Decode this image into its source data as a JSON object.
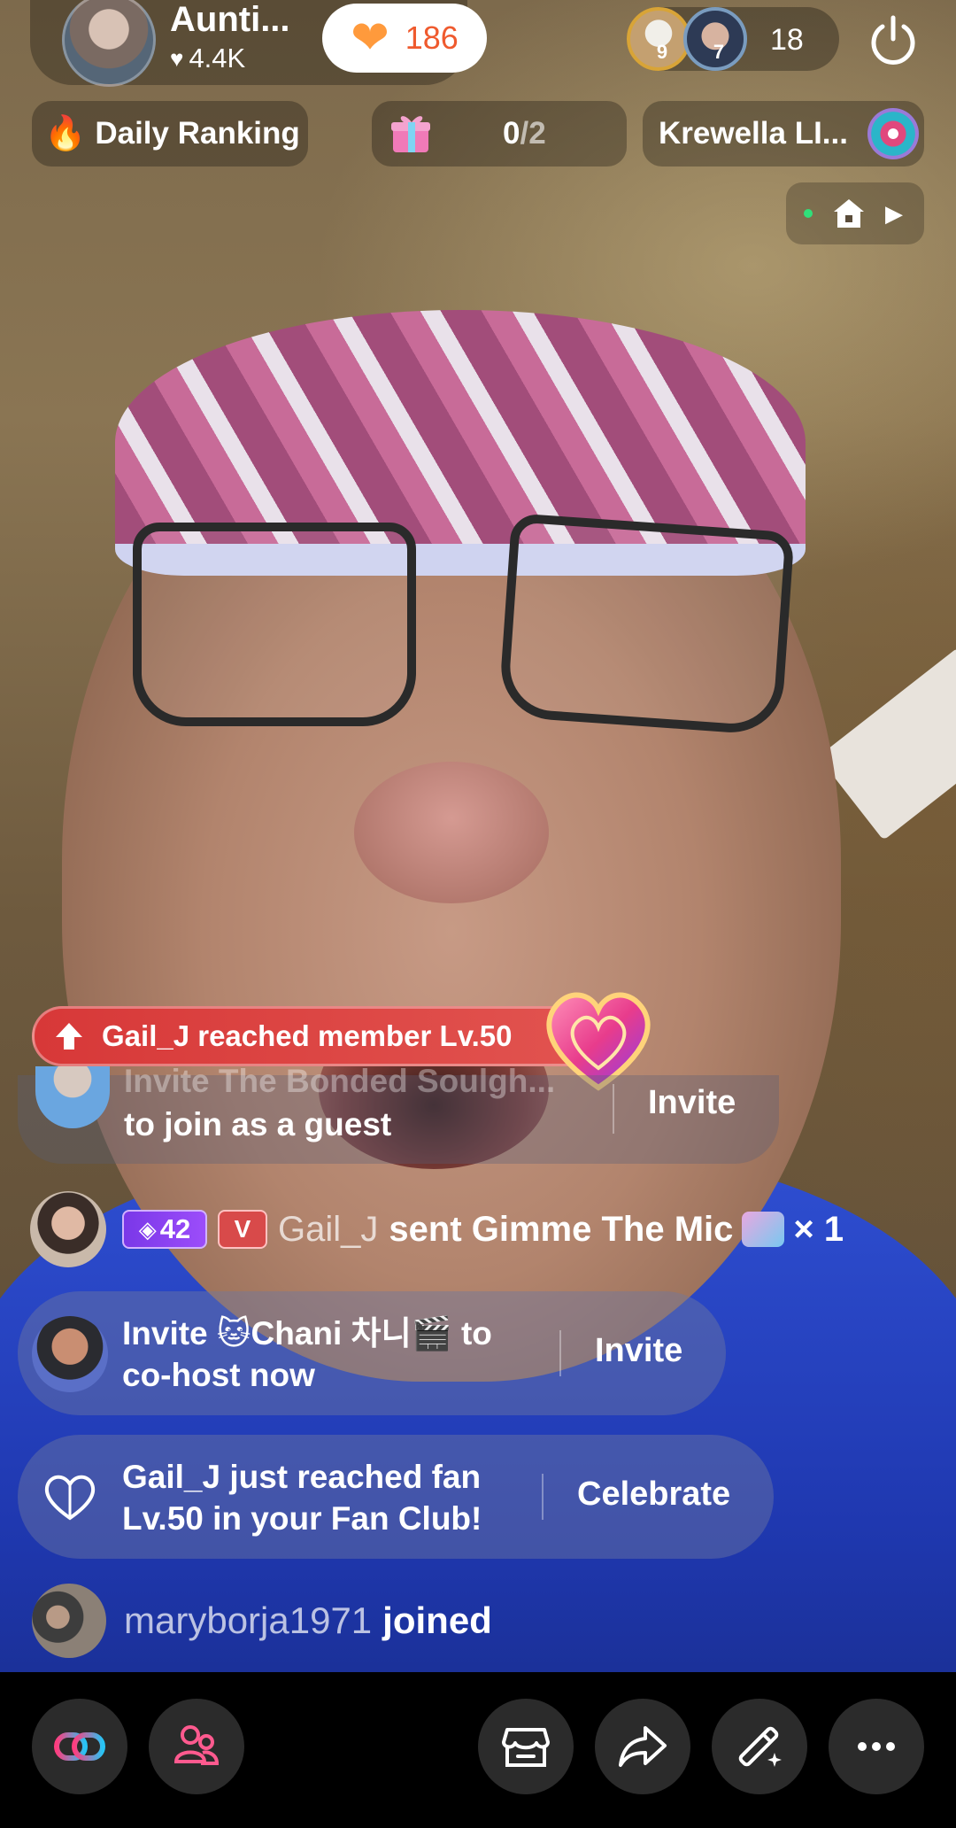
{
  "host": {
    "name": "Aunti...",
    "likes": "4.4K",
    "follow_count": "186"
  },
  "viewers": {
    "top_badges": [
      "9",
      "7"
    ],
    "count": "18"
  },
  "chips": {
    "ranking": "Daily Ranking",
    "gift_goal_current": "0",
    "gift_goal_total": "/2",
    "music": "Krewella LI..."
  },
  "banner": {
    "text": "Gail_J reached member Lv.50"
  },
  "guest_card": {
    "text_top": "Invite The Bonded Soulgh...",
    "text": "to join as a guest",
    "action": "Invite"
  },
  "gift_message": {
    "level": "42",
    "vip": "V",
    "user": "Gail_J",
    "message": "sent Gimme The Mic",
    "multiplier": "× 1"
  },
  "cohost_card": {
    "line1": "Invite 🐱Chani 차니🎬 to",
    "line2": "co-host now",
    "action": "Invite"
  },
  "fan_card": {
    "line1": "Gail_J just reached fan",
    "line2": "Lv.50 in your Fan Club!",
    "action": "Celebrate"
  },
  "join_message": {
    "user": "maryborja1971",
    "message": "joined"
  },
  "bottom_bar": {
    "buttons": [
      "link-icon",
      "guests-icon",
      "shop-icon",
      "share-icon",
      "magic-wand-icon",
      "more-icon"
    ]
  },
  "colors": {
    "banner": "#d73838",
    "follow_count": "#ef5a2e",
    "level_badge": "#7a38e8",
    "link_gradient_start": "#ff3d7f",
    "link_gradient_end": "#27c4f5"
  }
}
